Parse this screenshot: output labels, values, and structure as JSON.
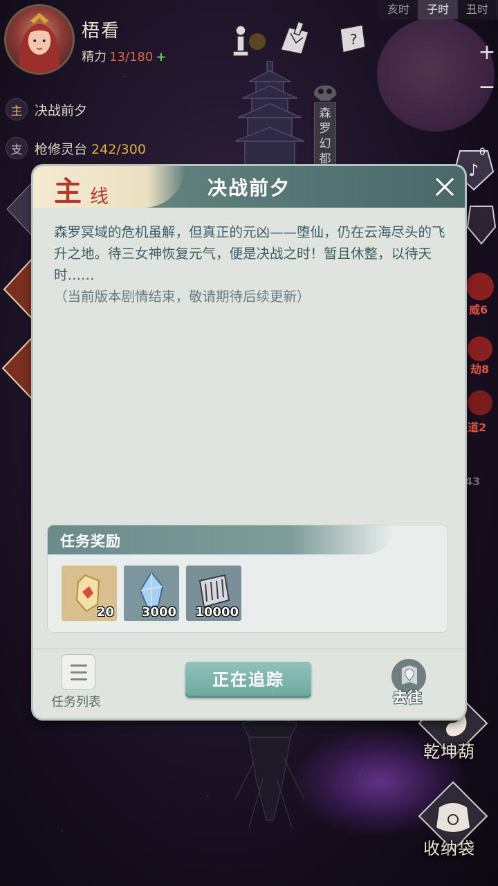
{
  "player": {
    "name": "梧看",
    "stamina_label": "精力",
    "stamina_value": "13/180",
    "stamina_plus": "+"
  },
  "quests": [
    {
      "tag": "主",
      "text": "决战前夕",
      "progress": ""
    },
    {
      "tag": "支",
      "text": "枪修灵台",
      "progress": "242/300"
    }
  ],
  "time_tabs": [
    "亥时",
    "子时",
    "丑时"
  ],
  "active_time_tab": "子时",
  "zoom": {
    "in": "+",
    "out": "−"
  },
  "location_sign": "森罗幻都",
  "right_panel": {
    "badge_count": "0",
    "stats": [
      "威6",
      "劫8",
      "道2",
      "43"
    ],
    "items": [
      {
        "label": "乾坤葫",
        "icon": "gourd-icon"
      },
      {
        "label": "收纳袋",
        "icon": "bag-icon"
      }
    ]
  },
  "dialog": {
    "tab_big": "主",
    "tab_small": "线",
    "title": "决战前夕",
    "close_label": "X",
    "description": "森罗冥域的危机虽解，但真正的元凶——堕仙，仍在云海尽头的飞升之地。待三女神恢复元气，便是决战之时！暂且休整，以待天时……",
    "note": "（当前版本剧情结束，敬请期待后续更新）",
    "rewards_title": "任务奖励",
    "rewards": [
      {
        "icon": "spirit-stone-icon",
        "count": "20"
      },
      {
        "icon": "crystal-icon",
        "count": "3000"
      },
      {
        "icon": "scroll-icon",
        "count": "10000"
      }
    ],
    "task_list_label": "任务列表",
    "track_label": "正在追踪",
    "goto_label": "去往"
  },
  "colors": {
    "header": "#5f7f7c",
    "main_tab_text": "#b23a2a",
    "body_text": "#3d5e63",
    "track_button": "#7fb5ae",
    "stamina_value": "#e06a45",
    "progress": "#e0b040"
  }
}
